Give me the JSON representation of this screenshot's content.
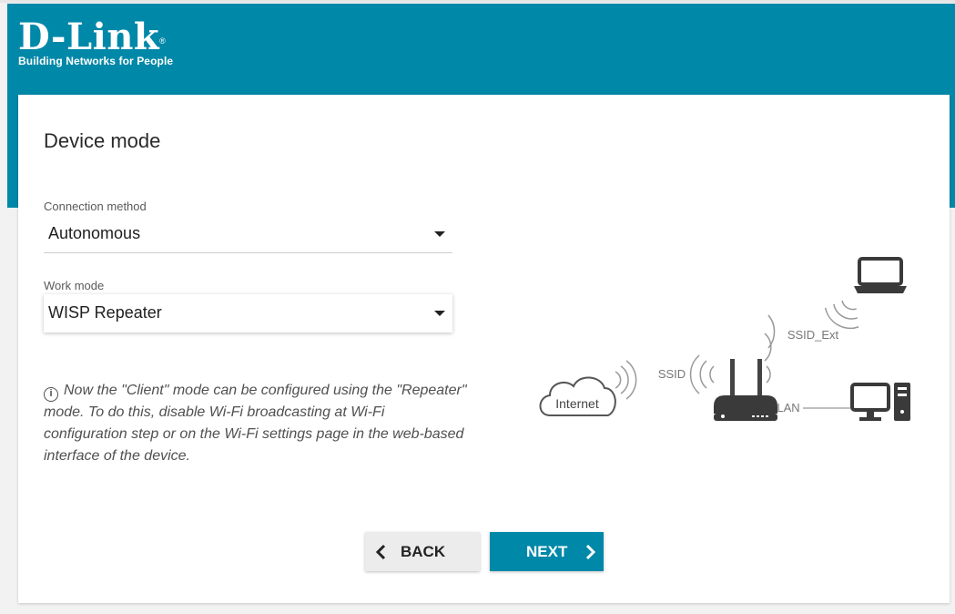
{
  "header": {
    "brand": "D-Link",
    "brand_mark": "®",
    "tagline": "Building Networks for People",
    "color": "#0088a8"
  },
  "page": {
    "title": "Device mode"
  },
  "form": {
    "connection_method": {
      "label": "Connection method",
      "value": "Autonomous"
    },
    "work_mode": {
      "label": "Work mode",
      "value": "WISP Repeater"
    }
  },
  "info": {
    "icon": "info-icon",
    "text": "Now the \"Client\" mode can be configured using the \"Repeater\" mode. To do this, disable Wi-Fi broadcasting at Wi-Fi configuration step or on the Wi-Fi settings page in the web-based interface of the device."
  },
  "diagram": {
    "internet": "Internet",
    "ssid": "SSID",
    "ssid_ext": "SSID_Ext",
    "lan": "LAN"
  },
  "buttons": {
    "back": "BACK",
    "next": "NEXT"
  }
}
